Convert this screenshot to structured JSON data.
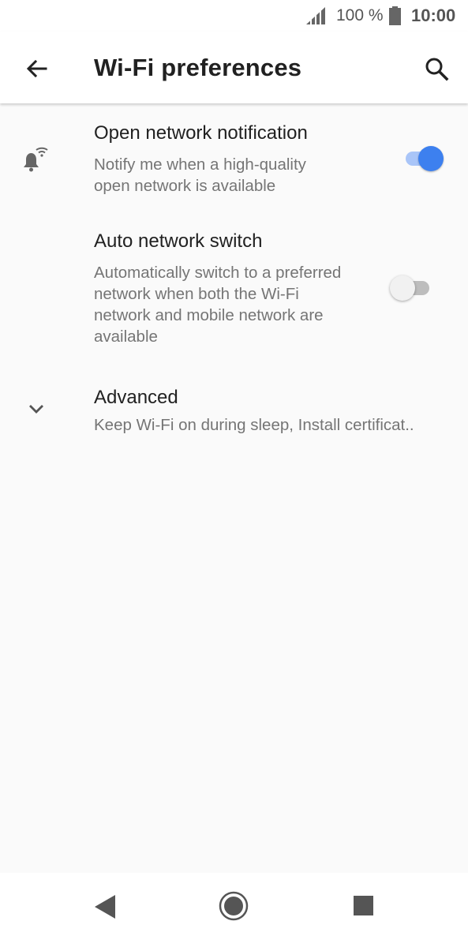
{
  "status_bar": {
    "battery_percent": "100 %",
    "time": "10:00",
    "icons": [
      "signal-icon",
      "battery-icon"
    ]
  },
  "app_bar": {
    "title": "Wi-Fi preferences",
    "back_icon": "arrow-back-icon",
    "search_icon": "search-icon"
  },
  "preferences": [
    {
      "icon": "notification-wifi-icon",
      "title": "Open network notification",
      "summary": "Notify me when a high-quality open network is available",
      "toggle": true
    },
    {
      "title": "Auto network switch",
      "summary": "Automatically switch to a preferred network when both the Wi-Fi network and mobile network are available",
      "toggle": false
    },
    {
      "icon": "chevron-down-icon",
      "title": "Advanced",
      "summary": "Keep Wi-Fi on during sleep, Install certificat.."
    }
  ],
  "nav_bar": {
    "buttons": [
      "back-triangle-icon",
      "home-circle-icon",
      "recents-square-icon"
    ]
  },
  "colors": {
    "accent": "#3d80ef",
    "accent_track": "#a9c5f8",
    "background": "#fafafa"
  }
}
